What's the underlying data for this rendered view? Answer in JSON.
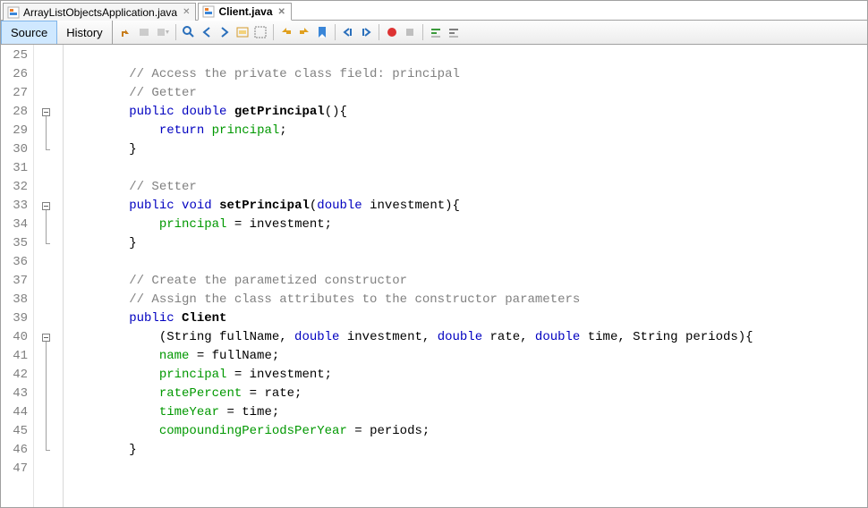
{
  "tabs": [
    {
      "label": "ArrayListObjectsApplication.java",
      "active": false
    },
    {
      "label": "Client.java",
      "active": true
    }
  ],
  "modes": {
    "source": "Source",
    "history": "History"
  },
  "first_line": 25,
  "line_count": 23,
  "code_lines": [
    {
      "n": 25,
      "t": "",
      "html": ""
    },
    {
      "n": 26,
      "t": "comment",
      "text": "        // Access the private class field: principal"
    },
    {
      "n": 27,
      "t": "comment",
      "text": "        // Getter"
    },
    {
      "n": 28,
      "t": "code",
      "html": "        <span class='kw'>public</span> <span class='kw'>double</span> <span class='bold'>getPrincipal</span>(){"
    },
    {
      "n": 29,
      "t": "code",
      "html": "            <span class='kw'>return</span> <span class='id'>principal</span>;"
    },
    {
      "n": 30,
      "t": "code",
      "html": "        }"
    },
    {
      "n": 31,
      "t": "",
      "html": ""
    },
    {
      "n": 32,
      "t": "comment",
      "text": "        // Setter"
    },
    {
      "n": 33,
      "t": "code",
      "html": "        <span class='kw'>public</span> <span class='kw'>void</span> <span class='bold'>setPrincipal</span>(<span class='kw'>double</span> investment){"
    },
    {
      "n": 34,
      "t": "code",
      "html": "            <span class='id'>principal</span> = investment;"
    },
    {
      "n": 35,
      "t": "code",
      "html": "        }"
    },
    {
      "n": 36,
      "t": "",
      "html": ""
    },
    {
      "n": 37,
      "t": "comment",
      "text": "        // Create the parametized constructor"
    },
    {
      "n": 38,
      "t": "comment",
      "text": "        // Assign the class attributes to the constructor parameters"
    },
    {
      "n": 39,
      "t": "code",
      "html": "        <span class='kw'>public</span> <span class='bold'>Client</span>"
    },
    {
      "n": 40,
      "t": "code",
      "html": "            (String fullName, <span class='kw'>double</span> investment, <span class='kw'>double</span> rate, <span class='kw'>double</span> time, String periods){"
    },
    {
      "n": 41,
      "t": "code",
      "html": "            <span class='id'>name</span> = fullName;"
    },
    {
      "n": 42,
      "t": "code",
      "html": "            <span class='id'>principal</span> = investment;"
    },
    {
      "n": 43,
      "t": "code",
      "html": "            <span class='id'>ratePercent</span> = rate;"
    },
    {
      "n": 44,
      "t": "code",
      "html": "            <span class='id'>timeYear</span> = time;"
    },
    {
      "n": 45,
      "t": "code",
      "html": "            <span class='id'>compoundingPeriodsPerYear</span> = periods;"
    },
    {
      "n": 46,
      "t": "code",
      "html": "        }"
    },
    {
      "n": 47,
      "t": "",
      "html": ""
    }
  ],
  "fold_markers": [
    {
      "line": 28,
      "end": 30
    },
    {
      "line": 33,
      "end": 35
    },
    {
      "line": 40,
      "end": 46
    }
  ],
  "toolbar_icons": [
    "last-edit-icon",
    "fwd-nav-icon",
    "fwd-nav-dd-icon",
    "sep",
    "find-select-icon",
    "find-prev-icon",
    "find-next-icon",
    "toggle-highlight-icon",
    "toggle-rect-icon",
    "sep",
    "prev-bookmark-icon",
    "next-bookmark-icon",
    "toggle-bookmark-icon",
    "sep",
    "shift-left-icon",
    "shift-right-icon",
    "sep",
    "macro-rec-icon",
    "macro-stop-icon",
    "sep",
    "comment-icon",
    "uncomment-icon"
  ]
}
